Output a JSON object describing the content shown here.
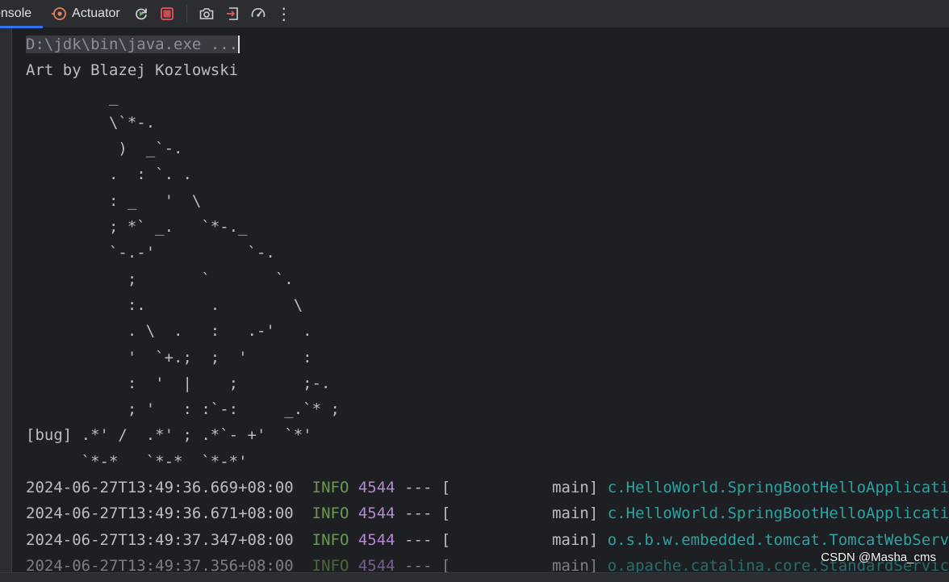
{
  "toolbar": {
    "tabs": [
      {
        "label": "onsole"
      },
      {
        "label": "Actuator"
      }
    ],
    "buttons": [
      {
        "icon": "rerun-icon"
      },
      {
        "icon": "stop-icon"
      },
      {
        "icon": "camera-icon"
      },
      {
        "icon": "exit-icon"
      },
      {
        "icon": "gauge-icon"
      },
      {
        "icon": "more-vertical-icon",
        "label": "⋮"
      }
    ]
  },
  "console": {
    "command": "D:\\jdk\\bin\\java.exe ...",
    "art_lines": [
      "Art by Blazej Kozlowski",
      "         _",
      "         \\`*-.",
      "          )  _`-.",
      "         .  : `. .",
      "         : _   '  \\",
      "         ; *` _.   `*-._",
      "         `-.-'          `-.",
      "           ;       `       `.",
      "           :.       .        \\",
      "           . \\  .   :   .-'   .",
      "           '  `+.;  ;  '      :",
      "           :  '  |    ;       ;-.",
      "           ; '   : :`-:     _.`* ;",
      "[bug] .*' /  .*' ; .*`- +'  `*'",
      "      `*-*   `*-*  `*-*'"
    ],
    "log_lines": [
      {
        "timestamp": "2024-06-27T13:49:36.669+08:00",
        "level": "INFO",
        "pid": "4544",
        "sep": "---",
        "thread": "[           main]",
        "logger": "c.HelloWorld.SpringBootHelloApplication"
      },
      {
        "timestamp": "2024-06-27T13:49:36.671+08:00",
        "level": "INFO",
        "pid": "4544",
        "sep": "---",
        "thread": "[           main]",
        "logger": "c.HelloWorld.SpringBootHelloApplication"
      },
      {
        "timestamp": "2024-06-27T13:49:37.347+08:00",
        "level": "INFO",
        "pid": "4544",
        "sep": "---",
        "thread": "[           main]",
        "logger": "o.s.b.w.embedded.tomcat.TomcatWebServer"
      },
      {
        "timestamp": "2024-06-27T13:49:37.356+08:00",
        "level": "INFO",
        "pid": "4544",
        "sep": "---",
        "thread": "[           main]",
        "logger": "o.apache.catalina.core.StandardService"
      }
    ]
  },
  "watermark": "CSDN @Masha_cms",
  "colors": {
    "background": "#1e1f22",
    "panel": "#2b2d30",
    "text": "#bcbec4",
    "info": "#6a9a4f",
    "pid": "#b589d4",
    "logger": "#2ba3a3",
    "stop": "#e55561",
    "accent": "#3574f0"
  }
}
